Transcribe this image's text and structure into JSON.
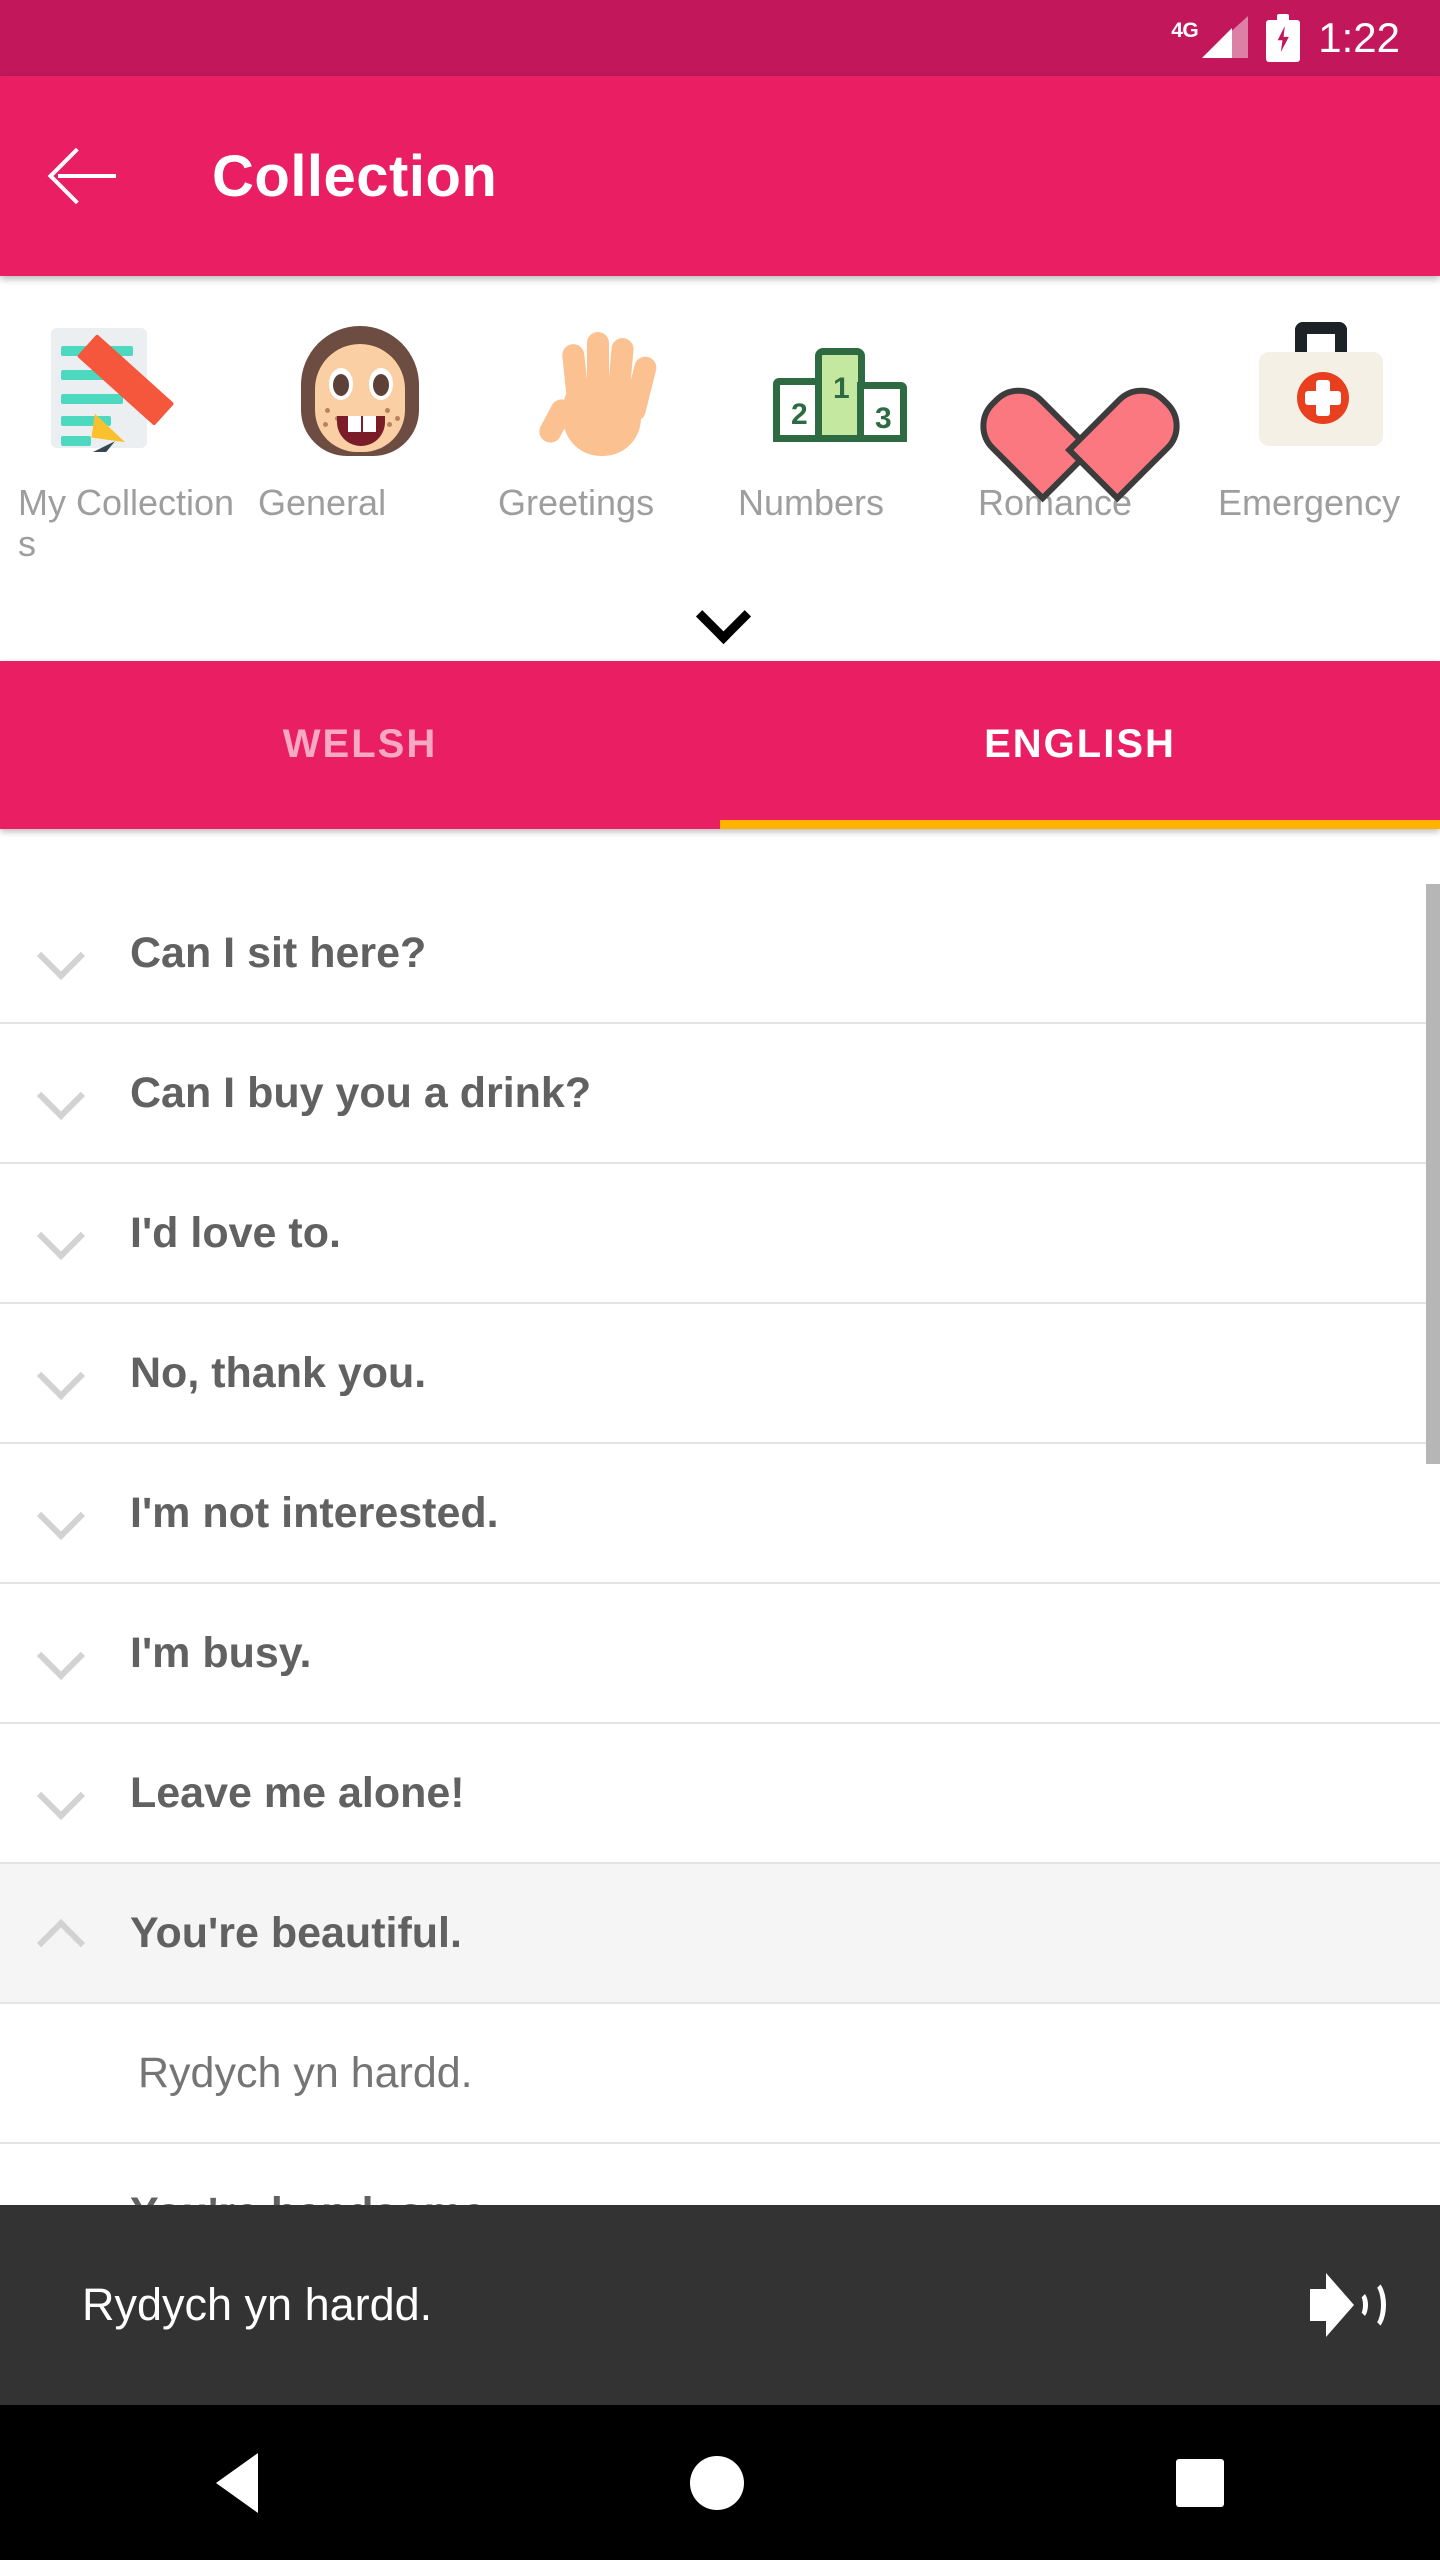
{
  "status_bar": {
    "network_label": "4G",
    "time": "1:22",
    "battery_state": "charging"
  },
  "app_bar": {
    "back_label": "back-arrow",
    "title": "Collection"
  },
  "categories": [
    {
      "label": "My Collections",
      "icon": "memo-pencil-icon"
    },
    {
      "label": "General",
      "icon": "girl-face-icon"
    },
    {
      "label": "Greetings",
      "icon": "raised-hand-icon"
    },
    {
      "label": "Numbers",
      "icon": "podium-icon"
    },
    {
      "label": "Romance",
      "icon": "heart-icon"
    },
    {
      "label": "Emergency",
      "icon": "first-aid-kit-icon"
    }
  ],
  "expand_categories": {
    "icon": "chevron-down-icon"
  },
  "tabs": [
    {
      "label": "WELSH",
      "active": false
    },
    {
      "label": "ENGLISH",
      "active": true
    }
  ],
  "phrases": [
    {
      "text": "Can I sit here?",
      "expanded": false,
      "translation": ""
    },
    {
      "text": "Can I buy you a drink?",
      "expanded": false,
      "translation": ""
    },
    {
      "text": "I'd love to.",
      "expanded": false,
      "translation": ""
    },
    {
      "text": "No, thank you.",
      "expanded": false,
      "translation": ""
    },
    {
      "text": "I'm not interested.",
      "expanded": false,
      "translation": ""
    },
    {
      "text": "I'm busy.",
      "expanded": false,
      "translation": ""
    },
    {
      "text": "Leave me alone!",
      "expanded": false,
      "translation": ""
    },
    {
      "text": "You're beautiful.",
      "expanded": true,
      "translation": "Rydych yn hardd."
    },
    {
      "text": "You're handsome.",
      "expanded": false,
      "translation": ""
    }
  ],
  "player": {
    "text": "Rydych yn hardd.",
    "speaker_icon": "volume-up-icon"
  },
  "nav_bar": {
    "back": "nav-back-icon",
    "home": "nav-home-icon",
    "recents": "nav-recents-icon"
  },
  "colors": {
    "status_bar": "#C2185B",
    "primary": "#E91E63",
    "tab_indicator": "#FFB300",
    "player_bg": "#333333",
    "row_text": "#616161"
  }
}
